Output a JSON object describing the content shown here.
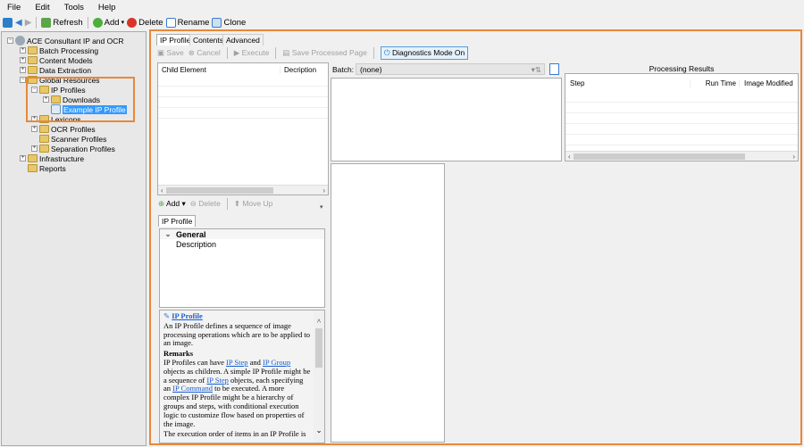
{
  "menu": [
    "File",
    "Edit",
    "Tools",
    "Help"
  ],
  "toolbar": {
    "refresh": "Refresh",
    "add": "Add",
    "delete": "Delete",
    "rename": "Rename",
    "clone": "Clone"
  },
  "tree": {
    "root": "ACE Consultant IP and OCR",
    "items": [
      "Batch Processing",
      "Content Models",
      "Data Extraction",
      "Global Resources",
      "IP Profiles",
      "Downloads",
      "Example IP Profile",
      "Lexicons",
      "OCR Profiles",
      "Scanner Profiles",
      "Separation Profiles",
      "Infrastructure",
      "Reports"
    ]
  },
  "tabs": [
    "IP Profile",
    "Contents",
    "Advanced"
  ],
  "actions": {
    "save": "Save",
    "cancel": "Cancel",
    "execute": "Execute",
    "save_processed": "Save Processed Page",
    "diagnostics": "Diagnostics Mode On"
  },
  "child_grid": {
    "columns": [
      "Child Element",
      "Decription"
    ]
  },
  "child_toolbar": {
    "add": "Add",
    "delete": "Delete",
    "move_up": "Move Up"
  },
  "prop_tab": "IP Profile",
  "props": {
    "category": "General",
    "rows": [
      "Description"
    ]
  },
  "batch": {
    "label": "Batch:",
    "value": "(none)"
  },
  "results": {
    "title": "Processing Results",
    "columns": [
      "Step",
      "Run Time",
      "Image Modified"
    ]
  },
  "help": {
    "title": "IP Profile",
    "intro": "An IP Profile defines a sequence of image processing operations which are to be applied to an image.",
    "remarks": "Remarks",
    "p1a": "IP Profiles can have ",
    "l1": "IP Step",
    "p1b": " and ",
    "l2": "IP Group",
    "p1c": " objects as children. A simple IP Profile might be a sequence of ",
    "l3": "IP Step",
    "p1d": " objects, each specifying an ",
    "l4": "IP Command",
    "p1e": " to be executed. A more complex IP Profile might be a hierarchy of groups and steps, with conditional execution logic to customize flow based on properties of the image.",
    "p2": "The execution order of items in an IP Profile is"
  }
}
